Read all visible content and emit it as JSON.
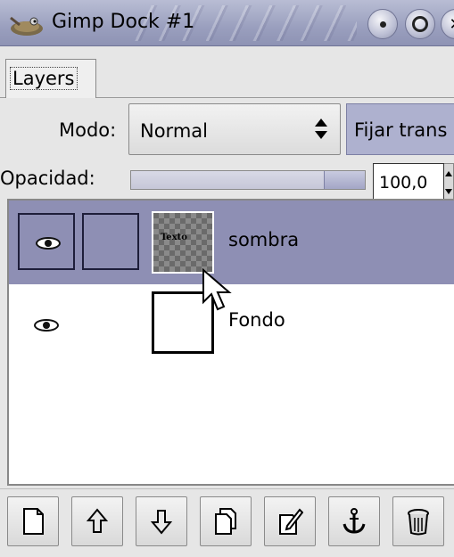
{
  "window": {
    "title": "Gimp Dock #1"
  },
  "tabs": [
    {
      "label": "Layers"
    }
  ],
  "mode": {
    "label": "Modo:",
    "value": "Normal",
    "keep_trans_label": "Fijar trans"
  },
  "opacity": {
    "label": "Opacidad:",
    "value": "100,0",
    "level_percent": 100
  },
  "layers": [
    {
      "name": "sombra",
      "thumb_text": "Texto",
      "visible": true,
      "selected": true
    },
    {
      "name": "Fondo",
      "visible": true,
      "selected": false
    }
  ],
  "toolbar": {
    "buttons": [
      {
        "icon": "new-layer-icon"
      },
      {
        "icon": "raise-layer-icon"
      },
      {
        "icon": "lower-layer-icon"
      },
      {
        "icon": "duplicate-layer-icon"
      },
      {
        "icon": "edit-layer-icon"
      },
      {
        "icon": "anchor-layer-icon"
      },
      {
        "icon": "trash-icon"
      }
    ]
  },
  "colors": {
    "selection": "#8e8fb4",
    "titlebar": "#9a9fbe"
  }
}
